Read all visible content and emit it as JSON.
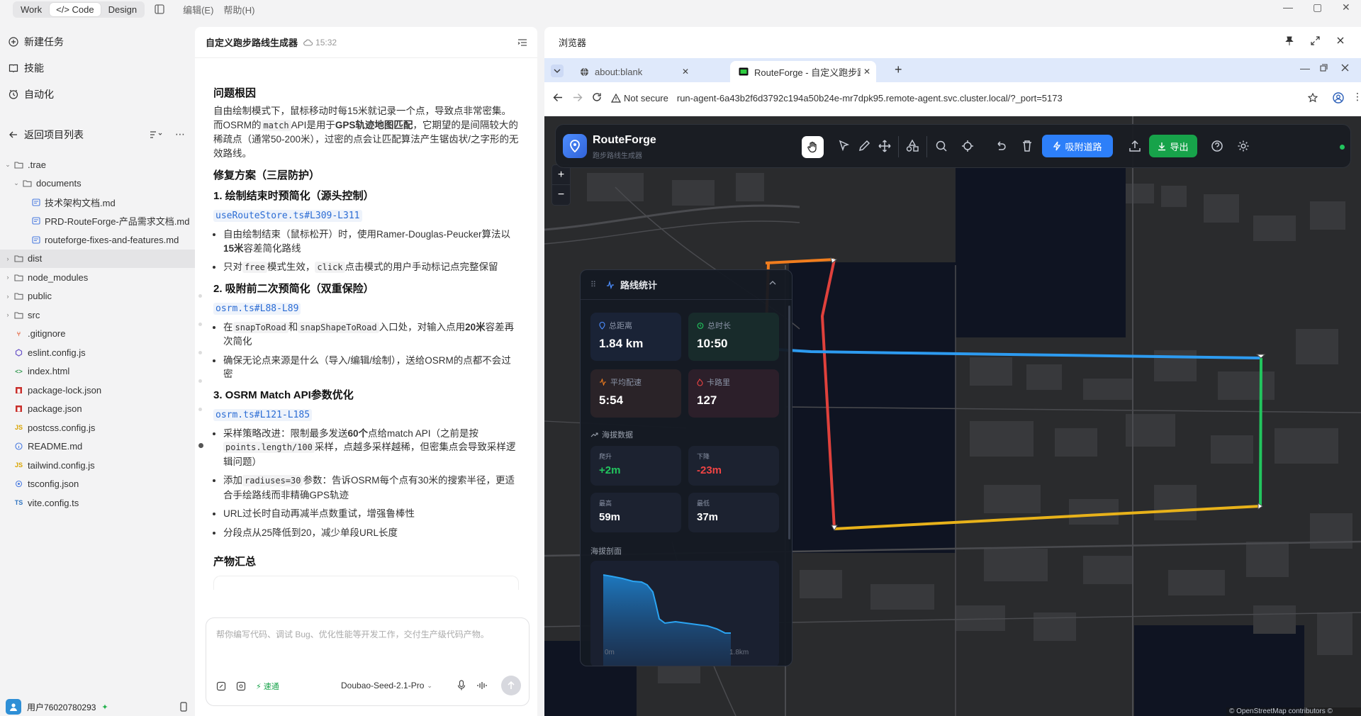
{
  "titlebar": {
    "modes": [
      "Work",
      "</> Code",
      "Design"
    ],
    "menus": [
      "编辑(E)",
      "帮助(H)"
    ]
  },
  "sidebar": {
    "top_items": [
      {
        "icon": "plus-circle-icon",
        "label": "新建任务"
      },
      {
        "icon": "book-icon",
        "label": "技能"
      },
      {
        "icon": "clock-icon",
        "label": "自动化"
      }
    ],
    "back_label": "返回项目列表",
    "tree": [
      {
        "indent": 0,
        "chev": "v",
        "type": "folder",
        "name": ".trae"
      },
      {
        "indent": 1,
        "chev": "v",
        "type": "folder",
        "name": "documents"
      },
      {
        "indent": 2,
        "chev": "",
        "type": "doc",
        "name": "技术架构文档.md"
      },
      {
        "indent": 2,
        "chev": "",
        "type": "doc",
        "name": "PRD-RouteForge-产品需求文档.md"
      },
      {
        "indent": 2,
        "chev": "",
        "type": "doc",
        "name": "routeforge-fixes-and-features.md"
      },
      {
        "indent": 0,
        "chev": ">",
        "type": "folder",
        "name": "dist",
        "selected": true
      },
      {
        "indent": 0,
        "chev": ">",
        "type": "folder",
        "name": "node_modules"
      },
      {
        "indent": 0,
        "chev": ">",
        "type": "folder",
        "name": "public"
      },
      {
        "indent": 0,
        "chev": ">",
        "type": "folder",
        "name": "src"
      },
      {
        "indent": 0,
        "chev": "",
        "type": "git",
        "name": ".gitignore"
      },
      {
        "indent": 0,
        "chev": "",
        "type": "eslint",
        "name": "eslint.config.js"
      },
      {
        "indent": 0,
        "chev": "",
        "type": "html",
        "name": "index.html"
      },
      {
        "indent": 0,
        "chev": "",
        "type": "npm",
        "name": "package-lock.json"
      },
      {
        "indent": 0,
        "chev": "",
        "type": "npm",
        "name": "package.json"
      },
      {
        "indent": 0,
        "chev": "",
        "type": "js",
        "name": "postcss.config.js"
      },
      {
        "indent": 0,
        "chev": "",
        "type": "info",
        "name": "README.md"
      },
      {
        "indent": 0,
        "chev": "",
        "type": "js",
        "name": "tailwind.config.js"
      },
      {
        "indent": 0,
        "chev": "",
        "type": "ts-config",
        "name": "tsconfig.json"
      },
      {
        "indent": 0,
        "chev": "",
        "type": "ts",
        "name": "vite.config.ts"
      }
    ],
    "user": "用户76020780293"
  },
  "chat": {
    "title": "自定义跑步路线生成器",
    "time": "15:32",
    "sections": {
      "root_cause_title": "问题根因",
      "root_cause_text_1": "自由绘制模式下，鼠标移动时每15米就记录一个点，导致点非常密集。而OSRM的",
      "root_cause_code": "match",
      "root_cause_text_2": "API是用于",
      "root_cause_bold": "GPS轨迹地图匹配",
      "root_cause_text_3": "，它期望的是间隔较大的稀疏点（通常50-200米），过密的点会让匹配算法产生锯齿状/之字形的无效路线。",
      "fix_title": "修复方案（三层防护）",
      "fix1_title": "1. 绘制结束时预简化（源头控制）",
      "fix1_link": "useRouteStore.ts#L309-L311",
      "fix1_b1_a": "自由绘制结束（鼠标松开）时，使用Ramer-Douglas-Peucker算法以",
      "fix1_b1_bold": "15米",
      "fix1_b1_b": "容差简化路线",
      "fix1_b2_a": "只对",
      "fix1_b2_code1": "free",
      "fix1_b2_b": "模式生效，",
      "fix1_b2_code2": "click",
      "fix1_b2_c": "点击模式的用户手动标记点完整保留",
      "fix2_title": "2. 吸附前二次预简化（双重保险）",
      "fix2_link": "osrm.ts#L88-L89",
      "fix2_b1_a": "在",
      "fix2_b1_code1": "snapToRoad",
      "fix2_b1_b": "和",
      "fix2_b1_code2": "snapShapeToRoad",
      "fix2_b1_c": "入口处，对输入点用",
      "fix2_b1_bold": "20米",
      "fix2_b1_d": "容差再次简化",
      "fix2_b2": "确保无论点来源是什么（导入/编辑/绘制），送给OSRM的点都不会过密",
      "fix3_title": "3. OSRM Match API参数优化",
      "fix3_link": "osrm.ts#L121-L185",
      "fix3_b1_a": "采样策略改进：限制最多发送",
      "fix3_b1_bold": "60个",
      "fix3_b1_b": "点给match API（之前是按",
      "fix3_b1_code": "points.length/100",
      "fix3_b1_c": "采样，点越多采样越稀，但密集点会导致采样逻辑问题）",
      "fix3_b2_a": "添加",
      "fix3_b2_code": "radiuses=30",
      "fix3_b2_b": "参数：告诉OSRM每个点有30米的搜索半径，更适合手绘路线而非精确GPS轨迹",
      "fix3_b3": "URL过长时自动再减半点数重试，增强鲁棒性",
      "fix3_b4": "分段点从25降低到20，减少单段URL长度",
      "output_title": "产物汇总"
    },
    "composer": {
      "placeholder": "帮你编写代码、调试 Bug、优化性能等开发工作，交付生产级代码产物。",
      "speed": "速通",
      "model": "Doubao-Seed-2.1-Pro"
    }
  },
  "browser": {
    "panel_title": "浏览器",
    "tabs": [
      {
        "title": "about:blank"
      },
      {
        "title": "RouteForge - 自定义跑步路"
      }
    ],
    "url_badge": "Not secure",
    "url": "run-agent-6a43b2f6d3792c194a50b24e-mr7dpk95.remote-agent.svc.cluster.local/?_port=5173"
  },
  "app": {
    "name": "RouteForge",
    "subtitle": "跑步路线生成器",
    "snap_label": "吸附道路",
    "export_label": "导出",
    "zoom_in": "+",
    "zoom_out": "−",
    "attribution": "© OpenStreetMap contributors © CARTO",
    "stats": {
      "title": "路线统计",
      "distance_label": "总距离",
      "distance": "1.84 km",
      "duration_label": "总时长",
      "duration": "10:50",
      "pace_label": "平均配速",
      "pace": "5:54",
      "calories_label": "卡路里",
      "calories": "127",
      "elev_title": "海拔数据",
      "gain_label": "爬升",
      "gain": "+2m",
      "loss_label": "下降",
      "loss": "-23m",
      "max_label": "最高",
      "max": "59m",
      "min_label": "最低",
      "min": "37m",
      "profile_title": "海拔剖面",
      "axis_start": "0m",
      "axis_end": "1.8km"
    }
  },
  "colors": {
    "accent_blue": "#2d7ff9",
    "export_green": "#17a34a",
    "route_orange": "#f07d1e",
    "route_red": "#e0413c",
    "route_blue": "#2d9bf0",
    "route_green": "#22c55e",
    "route_yellow": "#e8b21a"
  }
}
